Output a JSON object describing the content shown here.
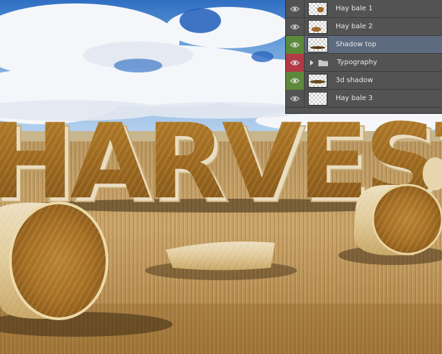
{
  "layers_panel": {
    "layers": [
      {
        "name": "Hay bale 1",
        "visibility_color": "none",
        "selected": false
      },
      {
        "name": "Hay bale 2",
        "visibility_color": "none",
        "selected": false
      },
      {
        "name": "Shadow top",
        "visibility_color": "#5c8a3a",
        "selected": true
      },
      {
        "name": "Typography",
        "visibility_color": "#b23a46",
        "selected": false,
        "is_group": true
      },
      {
        "name": "3d shadow",
        "visibility_color": "#5c8a3a",
        "selected": false
      },
      {
        "name": "Hay bale 3",
        "visibility_color": "none",
        "selected": false
      }
    ]
  },
  "canvas": {
    "headline": "HARVEST"
  },
  "icons": {
    "visibility": "eye-icon",
    "group": "folder-icon",
    "expand": "chevron-right-icon"
  }
}
